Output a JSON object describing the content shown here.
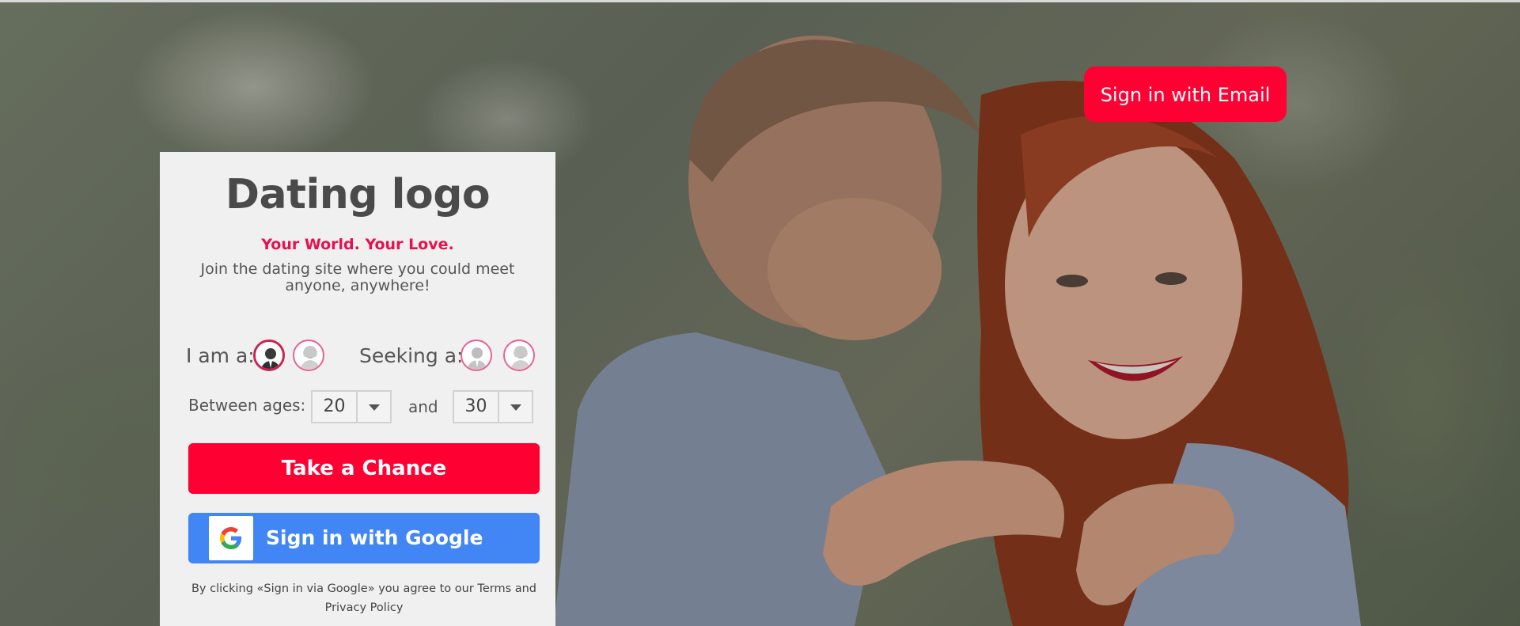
{
  "header": {
    "email_signin_label": "Sign in with Email"
  },
  "panel": {
    "logo": "Dating logo",
    "tagline": "Your World. Your Love.",
    "subtitle": "Join the dating site where you could meet anyone, anywhere!",
    "i_am_label": "I am a:",
    "seeking_label": "Seeking a:",
    "i_am_selected": "male",
    "seeking_selected": "none",
    "between_ages_label": "Between ages:",
    "and_label": "and",
    "age_min": "20",
    "age_max": "30",
    "take_chance_label": "Take a Chance",
    "google_label": "Sign in with Google",
    "legal_text": "By clicking «Sign in via Google» you agree to our Terms and Privacy Policy"
  },
  "colors": {
    "accent": "#ff0033",
    "tagline": "#e8104f",
    "google_blue": "#4285f4",
    "icon_border": "#e9638a"
  }
}
